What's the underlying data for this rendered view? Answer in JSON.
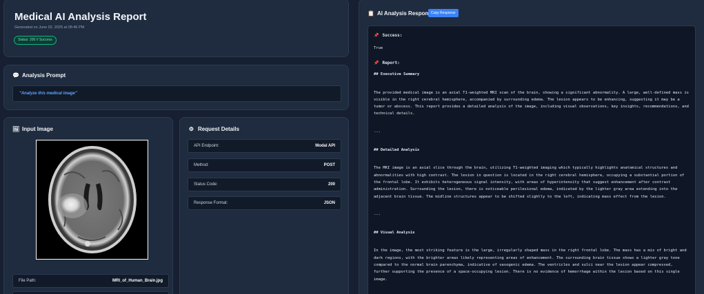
{
  "header": {
    "title": "Medical AI Analysis Report",
    "generated": "Generated on June 02, 2025 at 08:46 PM",
    "status": "Status: 200 // Success"
  },
  "prompt": {
    "heading": "Analysis Prompt",
    "text": "\"Analyze this medical image\""
  },
  "input_image": {
    "heading": "Input Image",
    "file_label": "File Path:",
    "file_value": "MRI_of_Human_Brain.jpg"
  },
  "request": {
    "heading": "Request Details",
    "rows": [
      {
        "k": "API Endpoint:",
        "v": "Modal API"
      },
      {
        "k": "Method:",
        "v": "POST"
      },
      {
        "k": "Status Code:",
        "v": "200"
      },
      {
        "k": "Response Format:",
        "v": "JSON"
      }
    ]
  },
  "response": {
    "heading": "AI Analysis Response",
    "copy_label": "Copy Response",
    "success_label": "Success:",
    "success_value": "True",
    "report_label": "Report:",
    "exec_heading": "## Executive Summary",
    "exec_text": "The provided medical image is an axial T1-weighted MRI scan of the brain, showing a significant abnormality. A large, well-defined mass is visible in the right cerebral hemisphere, accompanied by surrounding edema. The lesion appears to be enhancing, suggesting it may be a tumor or abscess. This report provides a detailed analysis of the image, including visual observations, key insights, recommendations, and technical details.",
    "sep1": "---",
    "detail_heading": "## Detailed Analysis",
    "detail_text": "The MRI image is an axial slice through the brain, utilizing T1-weighted imaging which typically highlights anatomical structures and abnormalities with high contrast. The lesion in question is located in the right cerebral hemisphere, occupying a substantial portion of the frontal lobe. It exhibits heterogeneous signal intensity, with areas of hyperintensity that suggest enhancement after contrast administration. Surrounding the lesion, there is noticeable perilesional edema, indicated by the lighter gray area extending into the adjacent brain tissue. The midline structures appear to be shifted slightly to the left, indicating mass effect from the lesion.",
    "sep2": "---",
    "visual_heading": "## Visual Analysis",
    "visual_text": "In the image, the most striking feature is the large, irregularly shaped mass in the right frontal lobe. The mass has a mix of bright and dark regions, with the brighter areas likely representing areas of enhancement. The surrounding brain tissue shows a lighter gray tone compared to the normal brain parenchyma, indicative of vasogenic edema. The ventricles and sulci near the lesion appear compressed, further supporting the presence of a space-occupying lesion. There is no evidence of hemorrhage within the lesion based on this single image."
  }
}
